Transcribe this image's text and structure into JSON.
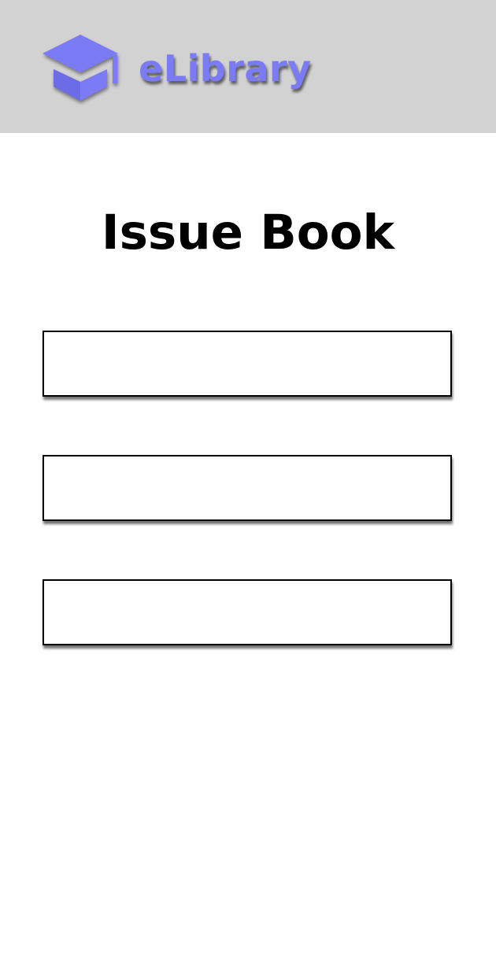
{
  "header": {
    "brand_name": "eLibrary",
    "logo_icon": "graduation-cap-icon",
    "background_color": "#d2d2d2",
    "brand_color": "#7b7bf6"
  },
  "page": {
    "title": "Issue Book"
  },
  "form": {
    "fields": [
      {
        "value": "",
        "placeholder": ""
      },
      {
        "value": "",
        "placeholder": ""
      },
      {
        "value": "",
        "placeholder": ""
      }
    ]
  }
}
